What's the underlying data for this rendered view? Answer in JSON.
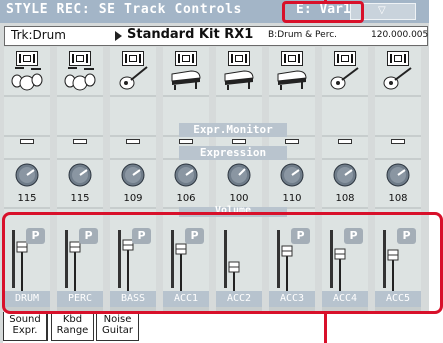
{
  "header": {
    "title": "STYLE REC: SE Track Controls",
    "variation": "E: Var1"
  },
  "track_info": {
    "track": "Trk:Drum",
    "sound": "Standard Kit RX1",
    "category": "B:Drum & Perc.",
    "program": "120.000.005"
  },
  "sections": {
    "monitor": "Expr.Monitor",
    "expression": "Expression",
    "volume": "Volume"
  },
  "tracks": [
    {
      "label": "DRUM",
      "expression": "115",
      "volume": "111",
      "volume_level": 111,
      "instrument": "drum-kit-icon"
    },
    {
      "label": "PERC",
      "expression": "115",
      "volume": "111",
      "volume_level": 111,
      "instrument": "drum-kit-icon"
    },
    {
      "label": "BASS",
      "expression": "109",
      "volume": "115",
      "volume_level": 115,
      "instrument": "bass-guitar-icon"
    },
    {
      "label": "ACC1",
      "expression": "106",
      "volume": "106",
      "volume_level": 106,
      "instrument": "grand-piano-icon"
    },
    {
      "label": "ACC2",
      "expression": "100",
      "volume": "68",
      "volume_level": 68,
      "instrument": "grand-piano-icon"
    },
    {
      "label": "ACC3",
      "expression": "110",
      "volume": "100",
      "volume_level": 100,
      "instrument": "grand-piano-icon"
    },
    {
      "label": "ACC4",
      "expression": "108",
      "volume": "94",
      "volume_level": 94,
      "instrument": "acoustic-guitar-icon"
    },
    {
      "label": "ACC5",
      "expression": "108",
      "volume": "92",
      "volume_level": 92,
      "instrument": "acoustic-guitar-icon"
    }
  ],
  "pan_button_label": "P",
  "tabs": [
    {
      "label": "Sound Expr.",
      "line1": "Sound",
      "line2": "Expr.",
      "active": true
    },
    {
      "label": "Kbd Range",
      "line1": "Kbd",
      "line2": "Range",
      "active": false
    },
    {
      "label": "Noise Guitar",
      "line1": "Noise",
      "line2": "Guitar",
      "active": false
    }
  ],
  "colors": {
    "highlight": "#d8102a",
    "title_bar": "#a3b5c7",
    "panel": "#dde3e2"
  }
}
